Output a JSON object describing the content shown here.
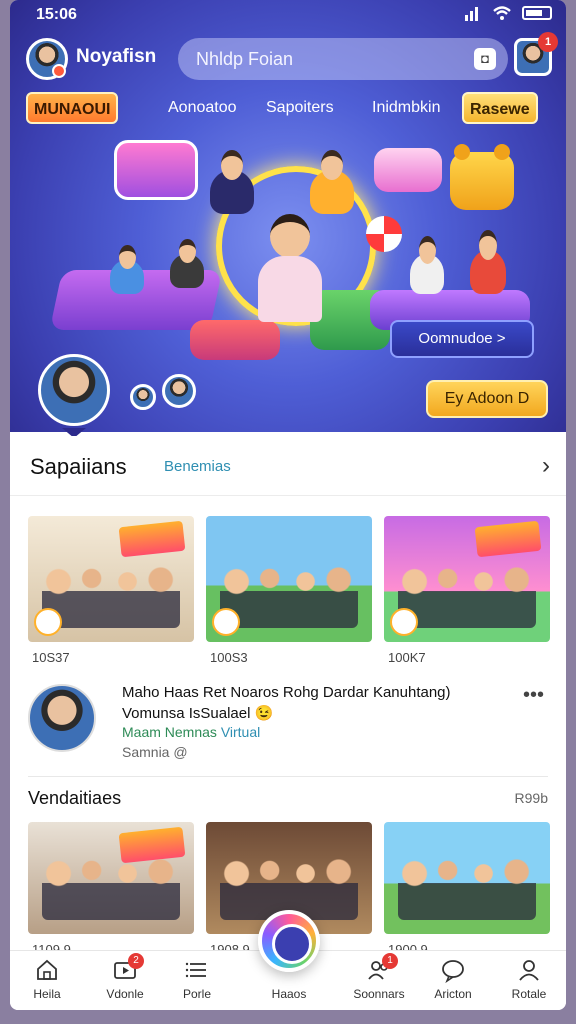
{
  "status": {
    "time": "15:06"
  },
  "header": {
    "username": "Noyafisn",
    "search_placeholder": "Nhldp Foian",
    "notification_count": "1"
  },
  "chips": [
    "MUNAOUI",
    "Aonoatoo",
    "Sapoiters",
    "Inidmbkin",
    "Rasewe"
  ],
  "hero": {
    "onboard_label": "Oomnudoe >",
    "cta_label": "Ey Adoon D"
  },
  "section1": {
    "title": "Sapaiians",
    "tag": "Benemias",
    "cards": [
      {
        "caption": "10S37"
      },
      {
        "caption": "100S3"
      },
      {
        "caption": "100K7"
      }
    ]
  },
  "post": {
    "title": "Maho Haas Ret Noaros Rohg Dardar Kanuhtang)",
    "line2": "Vomunsa IsSualael 😉",
    "channel": "Maam Nemnas",
    "channel_sub": "Virtual",
    "meta": "Samnia @"
  },
  "section2": {
    "title": "Vendaitiaes",
    "link": "R99b",
    "cards": [
      {
        "caption": "1109.9"
      },
      {
        "caption": "1908.9"
      },
      {
        "caption": "1900.9"
      }
    ]
  },
  "bottom_nav": [
    {
      "label": "Heila",
      "icon": "home-icon",
      "badge": ""
    },
    {
      "label": "Vdonle",
      "icon": "video-icon",
      "badge": "2"
    },
    {
      "label": "Porle",
      "icon": "list-icon",
      "badge": ""
    },
    {
      "label": "Haaos",
      "icon": "camera-icon",
      "badge": ""
    },
    {
      "label": "Soonnars",
      "icon": "people-icon",
      "badge": "1"
    },
    {
      "label": "Aricton",
      "icon": "chat-icon",
      "badge": ""
    },
    {
      "label": "Rotale",
      "icon": "profile-icon",
      "badge": ""
    }
  ],
  "colors": {
    "hero_bg": "#4f5fd6",
    "accent_orange": "#ff7a2e",
    "accent_yellow": "#f5b52e",
    "link_blue": "#2f8fb2",
    "badge_red": "#e53935"
  }
}
